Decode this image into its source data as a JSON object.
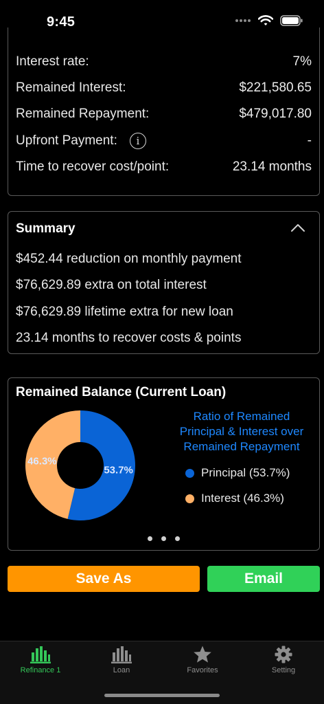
{
  "status_bar": {
    "time": "9:45"
  },
  "details": {
    "rows": [
      {
        "label": "Interest rate:",
        "value": "7%"
      },
      {
        "label": "Remained Interest:",
        "value": "$221,580.65"
      },
      {
        "label": "Remained Repayment:",
        "value": "$479,017.80"
      },
      {
        "label": "Upfront Payment:",
        "value": "-"
      },
      {
        "label": "Time to recover cost/point:",
        "value": "23.14 months"
      }
    ]
  },
  "summary": {
    "title": "Summary",
    "items": [
      "$452.44 reduction on monthly payment",
      "$76,629.89 extra on total interest",
      "$76,629.89 lifetime extra for new loan",
      "23.14 months to recover costs & points"
    ]
  },
  "chart_card": {
    "title": "Remained Balance (Current Loan)",
    "ratio_title_lines": [
      "Ratio of Remained",
      "Principal & Interest over",
      "Remained Repayment"
    ],
    "legend": [
      {
        "label": "Principal (53.7%)",
        "color": "#0a64d6"
      },
      {
        "label": "Interest (46.3%)",
        "color": "#ffb066"
      }
    ],
    "slice_labels": [
      "53.7%",
      "46.3%"
    ]
  },
  "chart_data": {
    "type": "pie",
    "categories": [
      "Principal",
      "Interest"
    ],
    "values": [
      53.7,
      46.3
    ],
    "colors": [
      "#0a64d6",
      "#ffb066"
    ],
    "title": "Remained Balance (Current Loan)",
    "donut": true
  },
  "buttons": {
    "save_as": "Save As",
    "email": "Email"
  },
  "tabs": [
    {
      "label": "Refinance 1",
      "icon": "bar-chart-icon",
      "active": true
    },
    {
      "label": "Loan",
      "icon": "bar-chart-icon",
      "active": false
    },
    {
      "label": "Favorites",
      "icon": "star-icon",
      "active": false
    },
    {
      "label": "Setting",
      "icon": "gear-icon",
      "active": false
    }
  ],
  "colors": {
    "accent_blue": "#1e88ff",
    "orange": "#ff9500",
    "green": "#30d158",
    "tab_active": "#34c759"
  }
}
